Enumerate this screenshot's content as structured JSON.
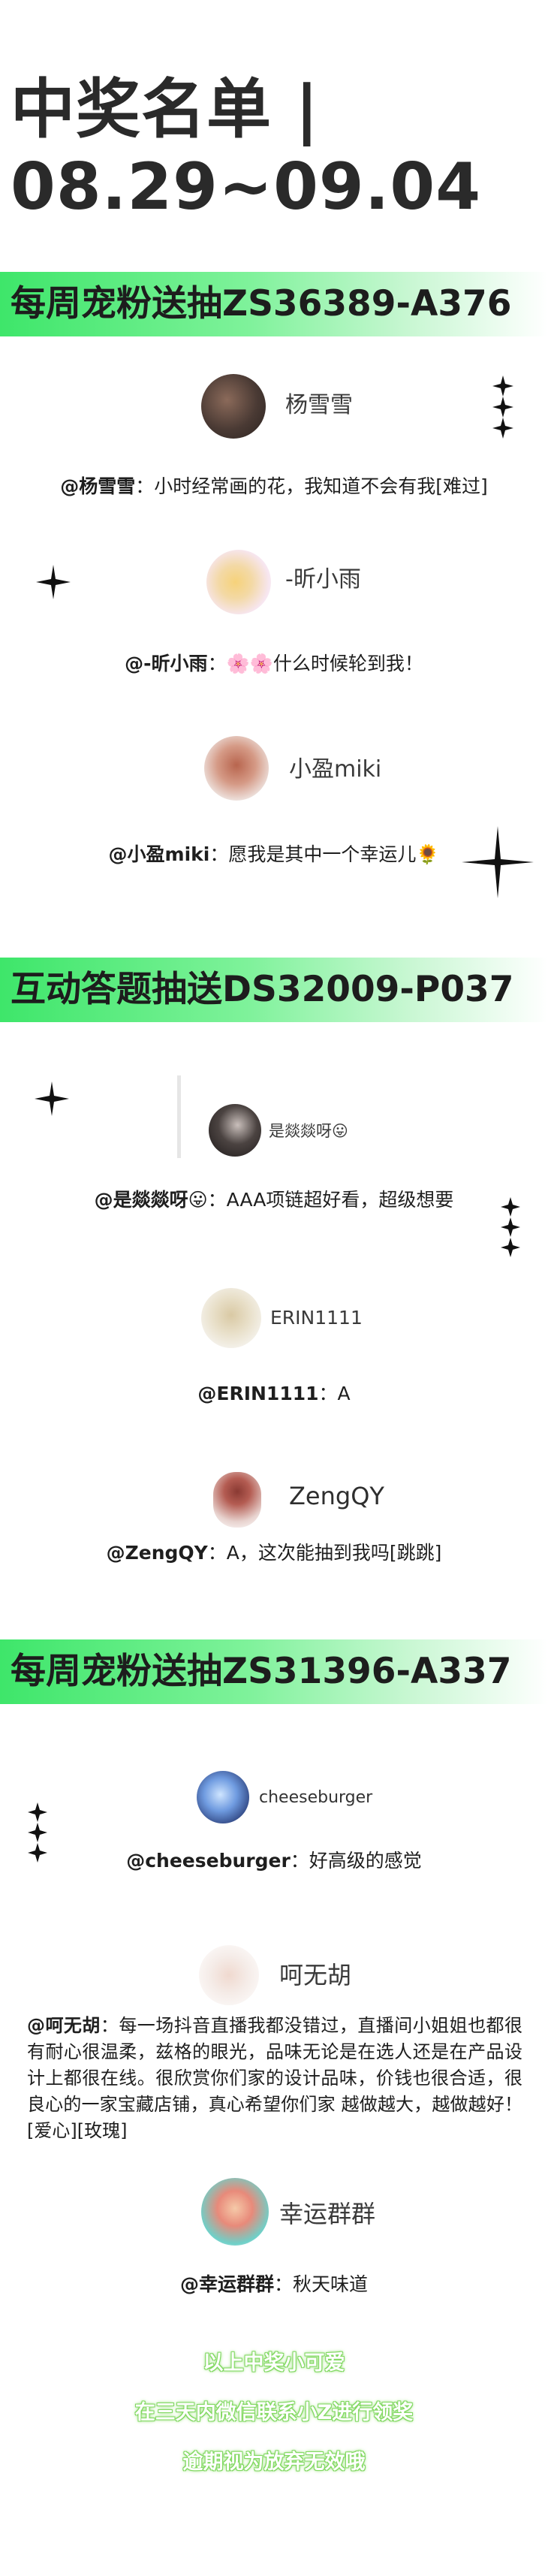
{
  "page": {
    "title_line1": "中奖名单 |",
    "title_line2": "08.29~09.04"
  },
  "sections": [
    {
      "banner": "每周宠粉送抽ZS36389-A376",
      "winners": [
        {
          "name": "杨雪雪",
          "handle": "@杨雪雪",
          "text": "：小时经常画的花，我知道不会有我[难过]"
        },
        {
          "name": "-昕小雨",
          "handle": "@-昕小雨",
          "text": "：🌸🌸什么时候轮到我！"
        },
        {
          "name": "小盈miki",
          "handle": "@小盈miki",
          "text": "：愿我是其中一个幸运儿🌻"
        }
      ]
    },
    {
      "banner": "互动答题抽送DS32009-P037",
      "winners": [
        {
          "name": "是燚燚呀😛",
          "handle": "@是燚燚呀😛",
          "text": "：AAA项链超好看，超级想要"
        },
        {
          "name": "ERIN1111",
          "handle": "@ERIN1111",
          "text": "：A"
        },
        {
          "name": "ZengQY",
          "handle": "@ZengQY",
          "text": "：A，这次能抽到我吗[跳跳]"
        }
      ]
    },
    {
      "banner": "每周宠粉送抽ZS31396-A337",
      "winners": [
        {
          "name": "cheeseburger",
          "handle": "@cheeseburger",
          "text": "：好高级的感觉"
        },
        {
          "name": "呵无胡",
          "handle": "@呵无胡",
          "text": "：每一场抖音直播我都没错过，直播间小姐姐也都很有耐心很温柔，兹格的眼光，品味无论是在选人还是在产品设计上都很在线。很欣赏你们家的设计品味，价钱也很合适，很良心的一家宝藏店铺，真心希望你们家 越做越大，越做越好！[爱心][玫瑰]"
        },
        {
          "name": "幸运群群",
          "handle": "@幸运群群",
          "text": "：秋天味道"
        }
      ]
    }
  ],
  "footer": {
    "line1": "以上中奖小可爱",
    "line2": "在三天内微信联系小Z进行领奖",
    "line3": "逾期视为放弃无效哦"
  },
  "colors": {
    "banner_green": "#3ee66a",
    "footer_green": "#7ad65a",
    "text": "#1e1e1e"
  },
  "icons": [
    "sparkle-icon",
    "avatar"
  ]
}
